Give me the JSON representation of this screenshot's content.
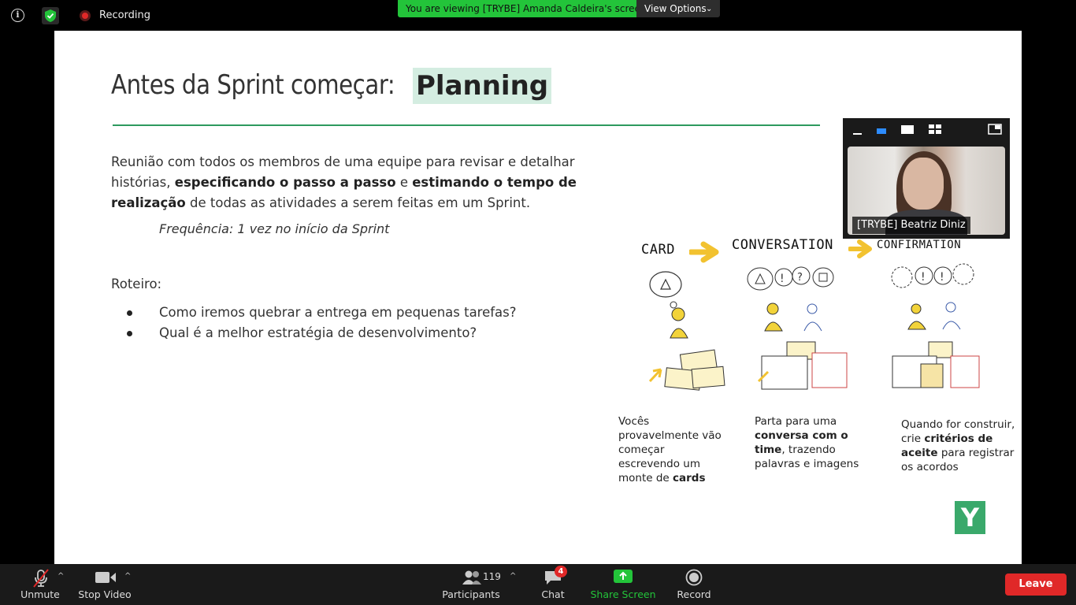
{
  "topbar": {
    "recording_label": "Recording",
    "viewing_banner": "You are viewing [TRYBE] Amanda Caldeira's screen",
    "view_options_label": "View Options"
  },
  "slide": {
    "title_prefix": "Antes da Sprint começar:",
    "title_highlight": "Planning",
    "para_1": "Reunião com todos os membros de uma equipe para revisar e detalhar histórias,",
    "para_bold_1": "especificando o passo a passo",
    "para_2": "e",
    "para_bold_2": "estimando o tempo de realização",
    "para_3": "de todas as atividades a serem feitas em um Sprint.",
    "frequency": "Frequência: 1 vez no início da Sprint",
    "roteiro_label": "Roteiro:",
    "bullets": [
      "Como iremos quebrar a entrega em pequenas tarefas?",
      "Qual é a melhor estratégia de desenvolvimento?"
    ],
    "stages": [
      {
        "title": "CARD"
      },
      {
        "title": "CONVERSATION"
      },
      {
        "title": "CONFIRMATION"
      }
    ],
    "captions": {
      "card_1": "Vocês provavelmente vão começar escrevendo um monte de",
      "card_bold": "cards",
      "conv_1": "Parta para uma",
      "conv_bold": "conversa com o time",
      "conv_2": ", trazendo palavras e imagens",
      "conf_1": "Quando for construir, crie",
      "conf_bold": "critérios de aceite",
      "conf_2": "para registrar os acordos"
    },
    "logo_letter": "Y"
  },
  "video": {
    "participant_name": "[TRYBE] Beatriz Diniz"
  },
  "bottombar": {
    "unmute_label": "Unmute",
    "stop_video_label": "Stop Video",
    "participants_count": "119",
    "participants_label": "Participants",
    "chat_label": "Chat",
    "chat_badge": "4",
    "share_screen_label": "Share Screen",
    "record_label": "Record",
    "leave_label": "Leave"
  },
  "colors": {
    "accent_green": "#23c43a",
    "rule_green": "#2e9a5e",
    "leave_red": "#e02828"
  }
}
